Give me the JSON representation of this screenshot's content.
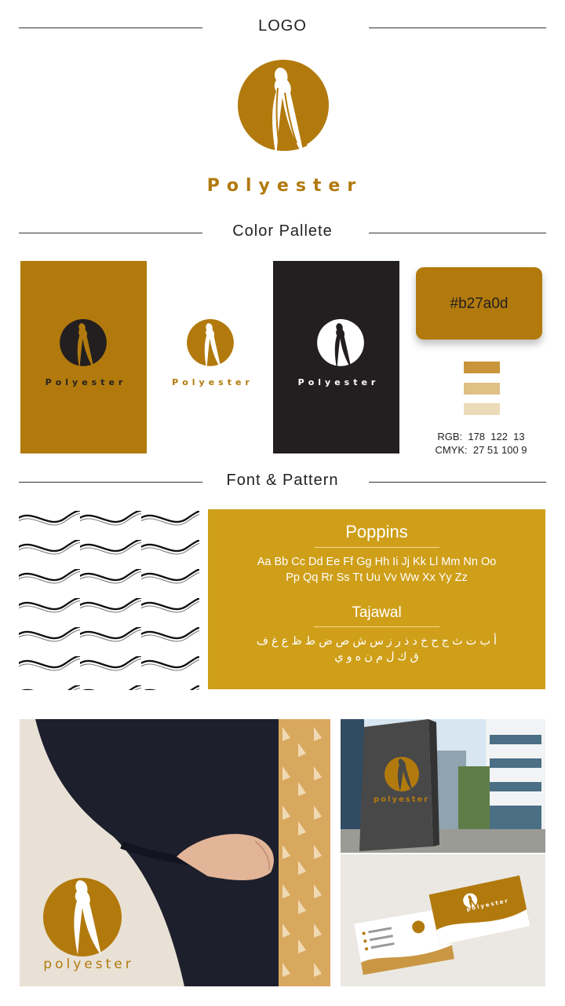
{
  "sections": {
    "logo": "LOGO",
    "palette": "Color Pallete",
    "fonts": "Font & Pattern"
  },
  "brand": {
    "name": "Polyester",
    "name_lower": "polyester",
    "mockup_name": "polyester"
  },
  "palette": {
    "hex": "#b27a0d",
    "rgb": "RGB:  178  122  13",
    "cmyk": "CMYK:  27 51 100 9",
    "colors": {
      "primary": "#b27a0d",
      "dark": "#231f20",
      "tint1": "#c8953a",
      "tint2": "#dfc085",
      "tint3": "#ecdab8",
      "font_card": "#cf9f19"
    }
  },
  "fonts": {
    "primary_name": "Poppins",
    "primary_line1": "Aa Bb Cc Dd Ee Ff Gg Hh Ii Jj Kk Ll Mm Nn Oo",
    "primary_line2": "Pp Qq Rr Ss Tt Uu Vv Ww Xx Yy Zz",
    "secondary_name": "Tajawal",
    "secondary_line1": "أ ب ت ث ج ح خ د ذ ر ز س ش ص ض ط ظ ع غ ف",
    "secondary_line2": "ق ك ل م ن ه و ي"
  }
}
